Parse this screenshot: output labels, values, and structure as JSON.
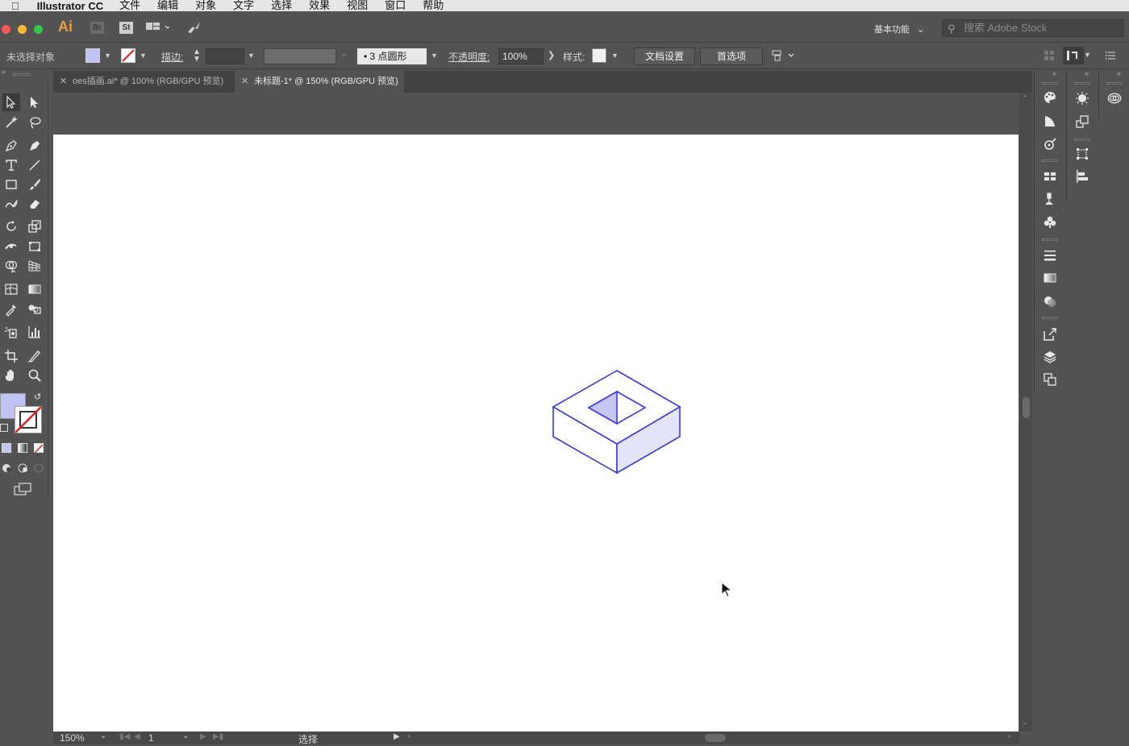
{
  "menubar": {
    "app_name": "Illustrator CC",
    "items": [
      "文件",
      "编辑",
      "对象",
      "文字",
      "选择",
      "效果",
      "视图",
      "窗口",
      "帮助"
    ]
  },
  "appbar": {
    "logo": "Ai",
    "bridge": "Br",
    "stock": "St",
    "workspace": "基本功能",
    "search_placeholder": "搜索 Adobe Stock"
  },
  "control": {
    "selection_status": "未选择对象",
    "stroke_label": "描边:",
    "brush_label": "3 点圆形",
    "opacity_label": "不透明度:",
    "opacity_value": "100%",
    "style_label": "样式:",
    "doc_setup": "文档设置",
    "preferences": "首选项"
  },
  "tabs": [
    {
      "label": "oes插画.ai* @ 100% (RGB/GPU 预览)",
      "active": false
    },
    {
      "label": "未标题-1* @ 150% (RGB/GPU 预览)",
      "active": true
    }
  ],
  "status": {
    "zoom": "150%",
    "page": "1",
    "tool": "选择"
  },
  "colors": {
    "stroke_line": "#3a3ad8",
    "fill_light": "#e4e4f8",
    "fill_inner": "#c5c6f2",
    "fill_swatch": "#c0c4f4",
    "accent_ai": "#f19a48"
  }
}
